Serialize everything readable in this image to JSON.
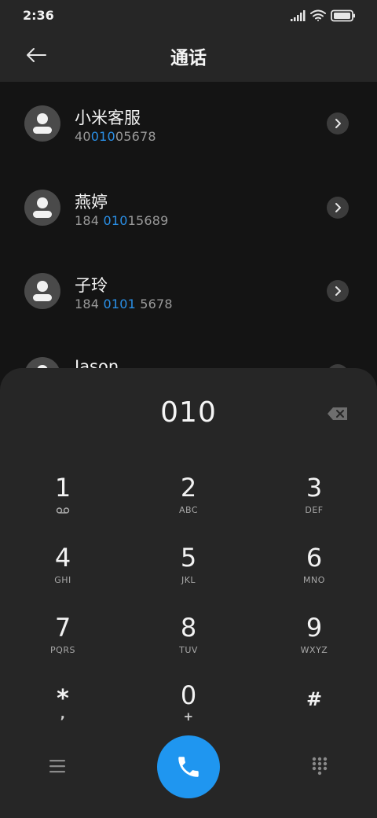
{
  "status_bar": {
    "time": "2:36"
  },
  "header": {
    "title": "通话",
    "back_icon": "back-arrow-icon"
  },
  "contacts": [
    {
      "name": "小米客服",
      "number_pre": "40",
      "number_match": "010",
      "number_post": "05678"
    },
    {
      "name": "燕婷",
      "number_pre": "184 ",
      "number_match": "010",
      "number_post": "15689"
    },
    {
      "name": "子玲",
      "number_pre": "184 ",
      "number_match": "0101",
      "number_post": " 5678"
    },
    {
      "name": "Jason",
      "number_pre": "",
      "number_match": "",
      "number_post": ""
    }
  ],
  "dialpad": {
    "input": "010",
    "keys": [
      {
        "digit": "1",
        "letters": "voicemail-icon"
      },
      {
        "digit": "2",
        "letters": "ABC"
      },
      {
        "digit": "3",
        "letters": "DEF"
      },
      {
        "digit": "4",
        "letters": "GHI"
      },
      {
        "digit": "5",
        "letters": "JKL"
      },
      {
        "digit": "6",
        "letters": "MNO"
      },
      {
        "digit": "7",
        "letters": "PQRS"
      },
      {
        "digit": "8",
        "letters": "TUV"
      },
      {
        "digit": "9",
        "letters": "WXYZ"
      },
      {
        "digit": "*",
        "letters": ","
      },
      {
        "digit": "0",
        "letters": "+"
      },
      {
        "digit": "#",
        "letters": ""
      }
    ]
  },
  "colors": {
    "accent": "#1f96f0",
    "match_highlight": "#2a8fe6",
    "panel": "#262626",
    "background": "#141414"
  }
}
